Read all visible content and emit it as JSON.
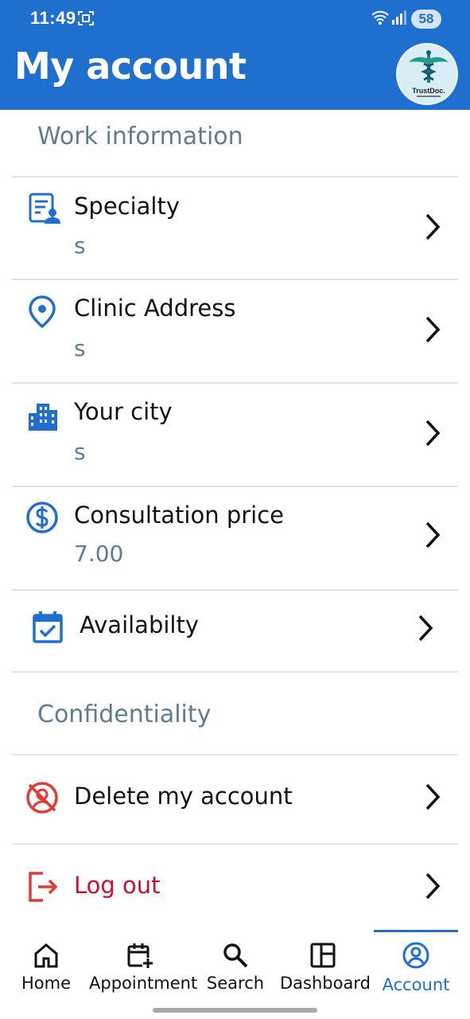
{
  "status_bar": {
    "time": "11:49",
    "battery": "58"
  },
  "header": {
    "title": "My account",
    "avatar_text": "TrustDoc."
  },
  "sections": {
    "work": "Work information",
    "confidentiality": "Confidentiality"
  },
  "work_items": [
    {
      "label": "Specialty",
      "value": "s",
      "icon": "specialty-icon"
    },
    {
      "label": "Clinic Address",
      "value": "s",
      "icon": "location-pin-icon"
    },
    {
      "label": "Your city",
      "value": "s",
      "icon": "city-icon"
    },
    {
      "label": "Consultation price",
      "value": "7.00",
      "icon": "dollar-icon"
    },
    {
      "label": "Availabilty",
      "icon": "calendar-check-icon"
    }
  ],
  "confidentiality_items": [
    {
      "label": "Delete my account",
      "icon": "delete-account-icon"
    },
    {
      "label": "Log out",
      "icon": "logout-icon"
    }
  ],
  "bottom_nav": [
    {
      "label": "Home",
      "icon": "home-icon"
    },
    {
      "label": "Appointment",
      "icon": "calendar-add-icon"
    },
    {
      "label": "Search",
      "icon": "search-icon"
    },
    {
      "label": "Dashboard",
      "icon": "dashboard-icon"
    },
    {
      "label": "Account",
      "icon": "account-icon",
      "active": true
    }
  ],
  "colors": {
    "primary": "#1f6fce",
    "section_title": "#5d7d93",
    "danger": "#e53935",
    "logout_text": "#c8102e"
  }
}
